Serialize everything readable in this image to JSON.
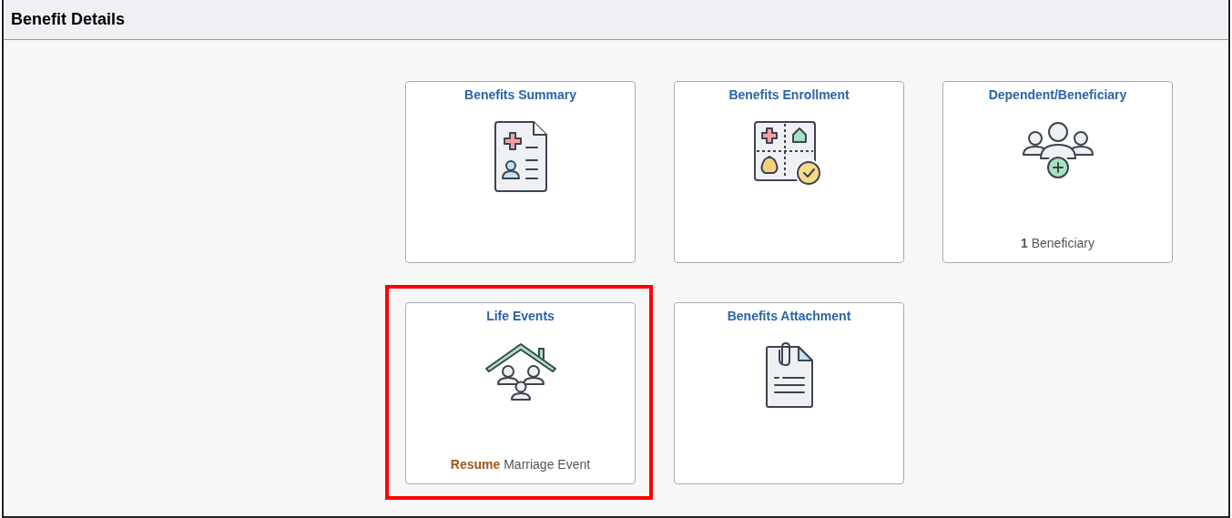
{
  "page": {
    "title": "Benefit Details"
  },
  "tiles": [
    {
      "title": "Benefits Summary",
      "highlighted": false
    },
    {
      "title": "Benefits Enrollment",
      "highlighted": false
    },
    {
      "title": "Dependent/Beneficiary",
      "highlighted": false,
      "footer": {
        "kind": "count",
        "strong": "1",
        "text": "Beneficiary"
      }
    },
    {
      "title": "Life Events",
      "highlighted": true,
      "footer": {
        "kind": "action",
        "strong": "Resume",
        "text": "Marriage Event"
      }
    },
    {
      "title": "Benefits Attachment",
      "highlighted": false
    }
  ]
}
